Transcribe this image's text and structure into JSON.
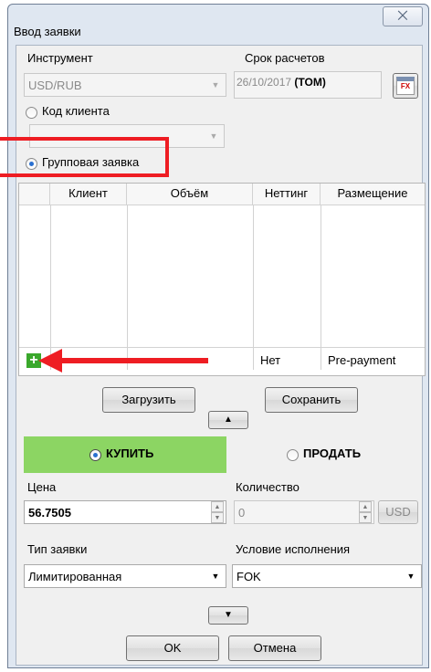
{
  "window": {
    "title": "Ввод заявки",
    "close_symbol": "⨉"
  },
  "instrument": {
    "label": "Инструмент",
    "value": "USD/RUB"
  },
  "settlement": {
    "label": "Срок расчетов",
    "date": "26/10/2017",
    "tenor": "(TOM)",
    "calendar_icon_text": "FX"
  },
  "client_code": {
    "label": "Код клиента",
    "value": "",
    "checked": false
  },
  "group_order": {
    "label": "Групповая заявка",
    "checked": true
  },
  "grid": {
    "columns": [
      "Клиент",
      "Объём",
      "Неттинг",
      "Размещение"
    ],
    "new_row": {
      "netting": "Нет",
      "placement": "Pre-payment"
    }
  },
  "actions": {
    "load": "Загрузить",
    "save": "Сохранить"
  },
  "side": {
    "buy": "КУПИТЬ",
    "sell": "ПРОДАТЬ",
    "selected": "buy"
  },
  "price": {
    "label": "Цена",
    "value": "56.7505"
  },
  "quantity": {
    "label": "Количество",
    "value": "0",
    "currency": "USD"
  },
  "order_type": {
    "label": "Тип заявки",
    "value": "Лимитированная"
  },
  "execution": {
    "label": "Условие исполнения",
    "value": "FOK"
  },
  "footer": {
    "ok": "OK",
    "cancel": "Отмена"
  },
  "colors": {
    "buy_band": "#8cd563",
    "highlight": "#ee1d23",
    "add_button": "#3aa82c"
  }
}
